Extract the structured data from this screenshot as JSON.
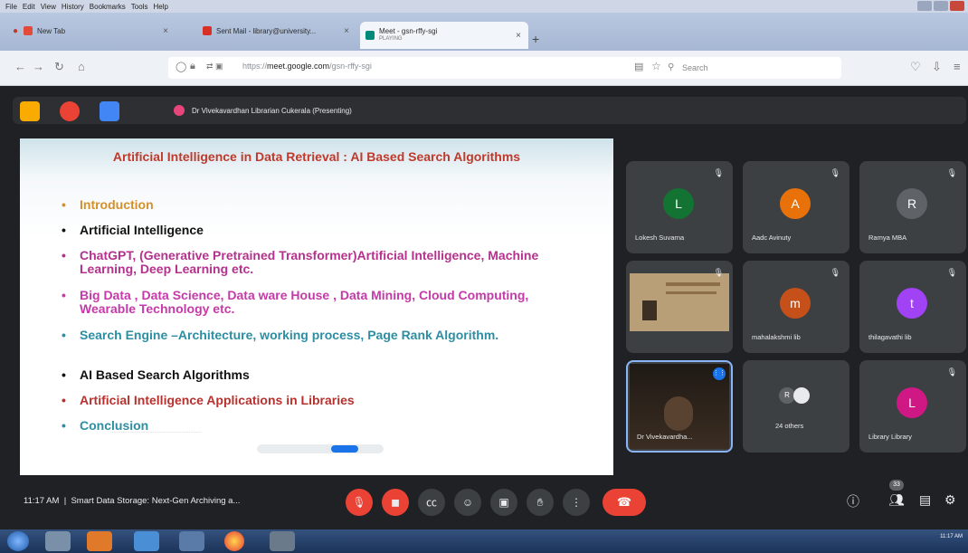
{
  "window": {
    "menu": [
      "File",
      "Edit",
      "View",
      "History",
      "Bookmarks",
      "Tools",
      "Help"
    ]
  },
  "tabs": [
    {
      "label": "New Tab"
    },
    {
      "label": "Sent Mail - library@university..."
    },
    {
      "label": "Meet - gsn-rffy-sgi",
      "sub": "PLAYING"
    }
  ],
  "address": {
    "prefix": "https://",
    "host": "meet.google.com",
    "path": "/gsn-rffy-sgi"
  },
  "search": {
    "placeholder": "Search"
  },
  "presenter": {
    "label": "Dr Vivekavardhan Librarian Cukerala (Presenting)"
  },
  "slide": {
    "title": "Artificial Intelligence in Data Retrieval : AI Based Search Algorithms",
    "bullets": [
      {
        "text": "Introduction",
        "color": "#d4902a"
      },
      {
        "text": "Artificial Intelligence",
        "color": "#111111"
      },
      {
        "text": "ChatGPT, (Generative Pretrained Transformer)Artificial Intelligence, Machine Learning, Deep Learning etc.",
        "color": "#b5318e"
      },
      {
        "text": "Big Data , Data Science, Data ware House , Data Mining, Cloud Computing, Wearable Technology etc.",
        "color": "#c53aa8"
      },
      {
        "text": "Search Engine –Architecture, working process, Page Rank Algorithm.",
        "color": "#2d8ea3"
      },
      {
        "text": "AI Based Search Algorithms",
        "color": "#111111"
      },
      {
        "text": "Artificial Intelligence Applications in Libraries",
        "color": "#b7322e"
      },
      {
        "text": "Conclusion",
        "color": "#2d8ea3"
      }
    ]
  },
  "participants": [
    {
      "name": "Lokesh Suvarna",
      "initial": "L",
      "color": "#137333"
    },
    {
      "name": "Aadc Avinuty",
      "initial": "A",
      "color": "#e8710a"
    },
    {
      "name": "Ramya MBA",
      "initial": "R",
      "color": "#5f6368"
    },
    {
      "name": "",
      "initial": "",
      "color": "#7a6a50"
    },
    {
      "name": "mahalakshmi lib",
      "initial": "m",
      "color": "#c5501a"
    },
    {
      "name": "thilagavathi lib",
      "initial": "t",
      "color": "#a142f4"
    },
    {
      "name": "Dr Vivekavardha...",
      "initial": "",
      "color": "#4a3a2a"
    },
    {
      "name": "24 others",
      "initial": "R",
      "color": "#5f6368"
    },
    {
      "name": "Library Library",
      "initial": "L",
      "color": "#d01884"
    }
  ],
  "meeting": {
    "time": "11:17 AM",
    "title": "Smart Data Storage: Next-Gen Archiving a..."
  },
  "people_count": "33",
  "taskbar": {
    "time": "11:17 AM",
    "date": ""
  }
}
